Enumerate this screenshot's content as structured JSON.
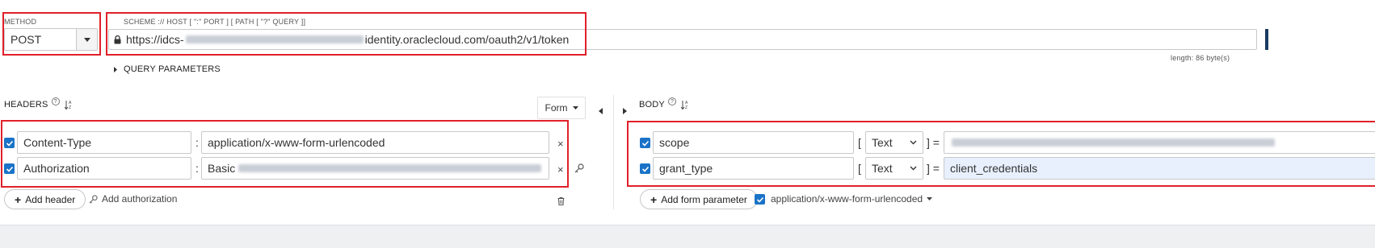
{
  "method": {
    "label": "METHOD",
    "value": "POST"
  },
  "url": {
    "label": "SCHEME :// HOST [ \":\" PORT ] [ PATH [ \"?\" QUERY ]]",
    "prefix": "https://idcs-",
    "suffix": "identity.oraclecloud.com/oauth2/v1/token",
    "length_text": "length: 86 byte(s)"
  },
  "query": {
    "label": "QUERY PARAMETERS"
  },
  "headers": {
    "title": "HEADERS",
    "form_button": "Form",
    "rows": [
      {
        "key": "Content-Type",
        "sep": ":",
        "value": "application/x-www-form-urlencoded"
      },
      {
        "key": "Authorization",
        "sep": ":",
        "value": "Basic"
      }
    ],
    "add_header": "Add header",
    "add_authorization": "Add authorization"
  },
  "body": {
    "title": "BODY",
    "rows": [
      {
        "key": "scope",
        "open": "[",
        "type": "Text",
        "close": "] =",
        "value": ""
      },
      {
        "key": "grant_type",
        "open": "[",
        "type": "Text",
        "close": "] =",
        "value": "client_credentials"
      }
    ],
    "add_form_parameter": "Add form parameter",
    "content_type": "application/x-www-form-urlencoded"
  },
  "colors": {
    "accent": "#1a73c7",
    "highlight": "#e0202a",
    "selected_field": "#e8f0fe"
  }
}
